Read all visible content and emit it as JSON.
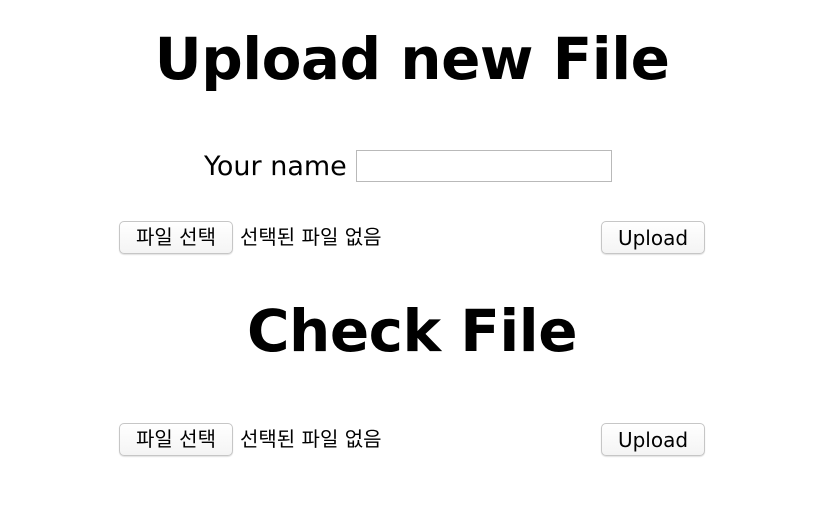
{
  "upload_section": {
    "title": "Upload new File",
    "name_label": "Your name",
    "name_value": "",
    "file_button_label": "파일 선택",
    "file_status": "선택된 파일 없음",
    "submit_label": "Upload"
  },
  "check_section": {
    "title": "Check File",
    "file_button_label": "파일 선택",
    "file_status": "선택된 파일 없음",
    "submit_label": "Upload"
  }
}
